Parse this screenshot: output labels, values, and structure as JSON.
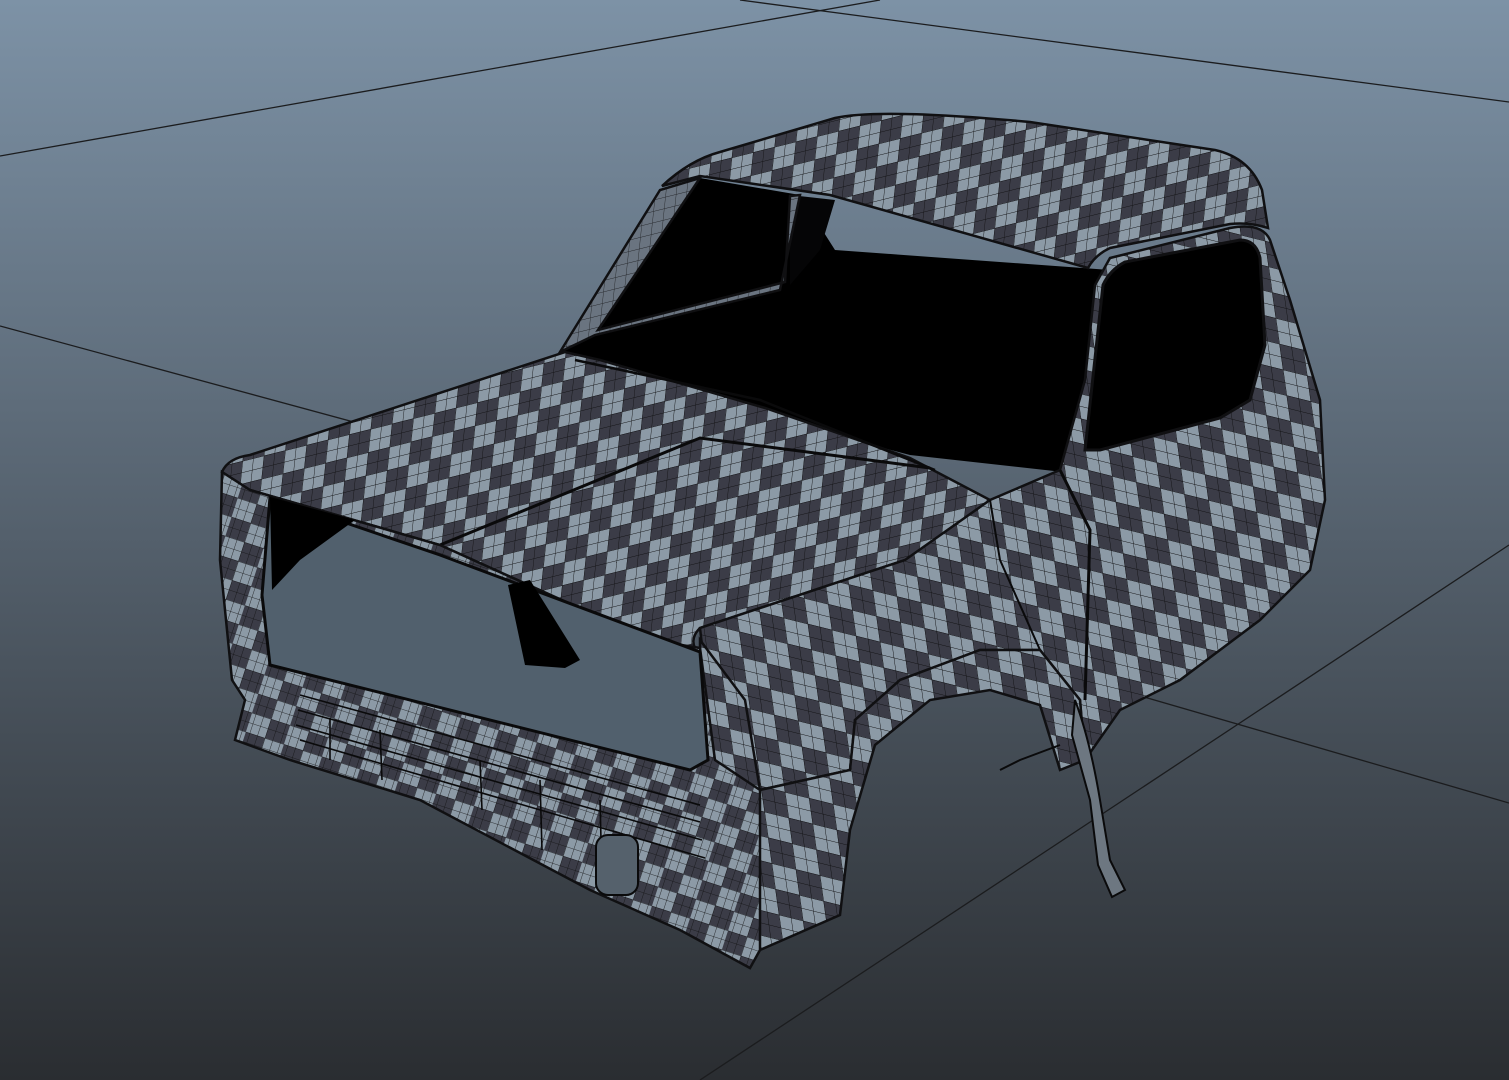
{
  "viewport": {
    "background_top_color": "#7d92a6",
    "background_bottom_color": "#2a2d31",
    "grid_line_color": "#1b1c1e",
    "show_grid": true
  },
  "model": {
    "shading": "uv-checker-wireframe",
    "checker_light_color": "#8c9aa6",
    "checker_dark_color": "#3b3c47",
    "wire_color": "#121214",
    "opening_color": "#000000"
  }
}
